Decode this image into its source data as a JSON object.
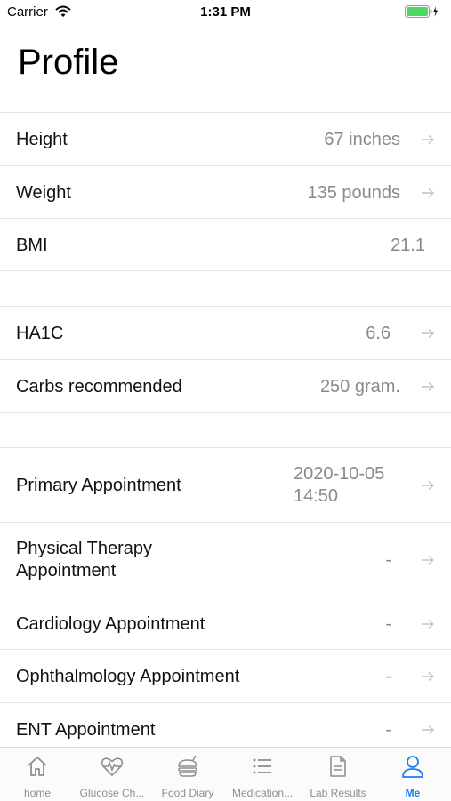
{
  "status_bar": {
    "carrier": "Carrier",
    "time": "1:31 PM"
  },
  "title": "Profile",
  "groups": [
    [
      {
        "label": "Height",
        "value": "67 inches"
      },
      {
        "label": "Weight",
        "value": "135 pounds"
      },
      {
        "label": "BMI",
        "value": "21.1"
      }
    ],
    [
      {
        "label": "HA1C",
        "value": "6.6"
      },
      {
        "label": "Carbs recommended",
        "value": "250 gram."
      }
    ],
    [
      {
        "label": "Primary Appointment",
        "value_line1": "2020-10-05",
        "value_line2": "14:50"
      },
      {
        "label_line1": "Physical Therapy",
        "label_line2": "Appointment",
        "value": "-"
      },
      {
        "label": "Cardiology Appointment",
        "value": "-"
      },
      {
        "label": "Ophthalmology Appointment",
        "value": "-"
      },
      {
        "label": "ENT Appointment",
        "value": "-"
      }
    ]
  ],
  "tabs": [
    {
      "label": "home",
      "icon": "home-icon"
    },
    {
      "label": "Glucose Ch...",
      "icon": "heart-pulse-icon"
    },
    {
      "label": "Food Diary",
      "icon": "food-icon"
    },
    {
      "label": "Medication...",
      "icon": "list-icon"
    },
    {
      "label": "Lab Results",
      "icon": "document-icon"
    },
    {
      "label": "Me",
      "icon": "person-icon",
      "active": true
    }
  ],
  "colors": {
    "accent": "#1c7cf4",
    "value_gray": "#8a8a8e",
    "battery": "#4cd964"
  }
}
